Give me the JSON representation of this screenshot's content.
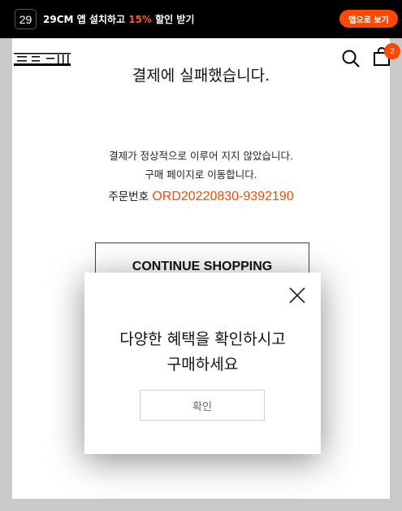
{
  "app_banner": {
    "icon_text": "29",
    "promo_prefix": "29CM 앱 설치하고 ",
    "promo_highlight": "15%",
    "promo_suffix": " 할인 받기",
    "open_app_label": "앱으로 보기",
    "accent_color": "#ff4800"
  },
  "header": {
    "logo": "29cm-logo",
    "search_icon": "search-icon",
    "cart_icon": "shopping-bag-icon",
    "cart_count": "2"
  },
  "result": {
    "title": "결제에 실패했습니다.",
    "message_line1": "결제가 정상적으로 이루어 지지 않았습니다.",
    "message_line2": "구매 페이지로 이동합니다.",
    "order_label": "주문번호 ",
    "order_number": "ORD20220830-9392190",
    "continue_label": "CONTINUE SHOPPING"
  },
  "modal": {
    "message_line1": "다양한 혜택을 확인하시고",
    "message_line2": "구매하세요",
    "ok_label": "확인",
    "close_icon": "close-icon"
  }
}
